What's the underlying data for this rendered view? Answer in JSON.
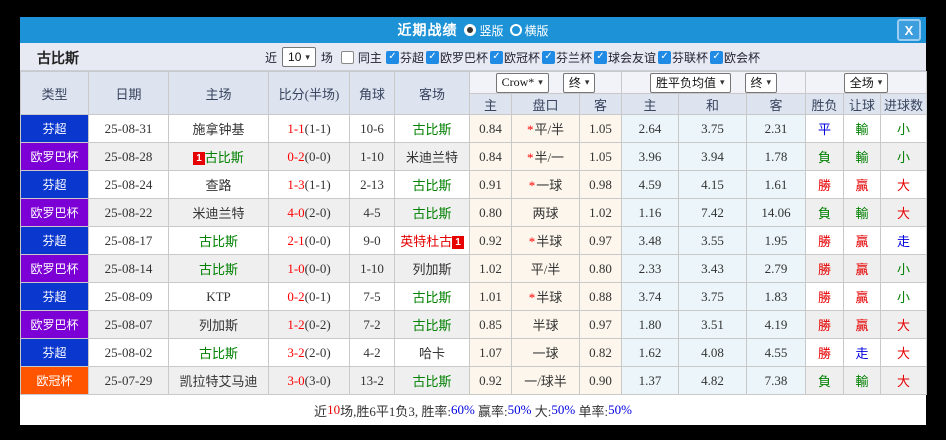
{
  "titlebar": {
    "title": "近期战绩",
    "layout_vertical": "竖版",
    "layout_horizontal": "横版",
    "close_label": "X"
  },
  "filterbar": {
    "team": "古比斯",
    "recent_prefix": "近",
    "recent_value": "10",
    "recent_suffix": "场",
    "same_home_label": "同主",
    "leagues": [
      "芬超",
      "欧罗巴杯",
      "欧冠杯",
      "芬兰杯",
      "球会友谊",
      "芬联杯",
      "欧会杯"
    ]
  },
  "table": {
    "main_headers": [
      "类型",
      "日期",
      "主场",
      "比分(半场)",
      "角球",
      "客场"
    ],
    "sub_headers": [
      "主",
      "盘口",
      "客",
      "主",
      "和",
      "客",
      "胜负",
      "让球",
      "进球数"
    ],
    "selects": {
      "odds_company": "Crow*",
      "odds_time": "终",
      "wdl_mode": "胜平负均值",
      "wdl_time": "终",
      "scope": "全场"
    },
    "rows": [
      {
        "league": "芬超",
        "date": "25-08-31",
        "home": "施拿钟基",
        "home_color": "dark",
        "home_card": "",
        "score": "1-1",
        "half": "(1-1)",
        "corner": "10-6",
        "away": "古比斯",
        "away_color": "green",
        "away_card": "",
        "ah_home": "0.84",
        "ah_line": "平/半",
        "ah_star": true,
        "ah_away": "1.05",
        "eu_home": "2.64",
        "eu_draw": "3.75",
        "eu_away": "2.31",
        "res_wdl": "平",
        "res_wdl_color": "blue",
        "res_ah": "輸",
        "res_ah_color": "green",
        "res_ou": "小",
        "res_ou_color": "green"
      },
      {
        "league": "欧罗巴杯",
        "date": "25-08-28",
        "home": "古比斯",
        "home_color": "green",
        "home_card": "1",
        "score": "0-2",
        "half": "(0-0)",
        "corner": "1-10",
        "away": "米迪兰特",
        "away_color": "dark",
        "away_card": "",
        "ah_home": "0.84",
        "ah_line": "半/一",
        "ah_star": true,
        "ah_away": "1.05",
        "eu_home": "3.96",
        "eu_draw": "3.94",
        "eu_away": "1.78",
        "res_wdl": "負",
        "res_wdl_color": "green",
        "res_ah": "輸",
        "res_ah_color": "green",
        "res_ou": "小",
        "res_ou_color": "green"
      },
      {
        "league": "芬超",
        "date": "25-08-24",
        "home": "查路",
        "home_color": "dark",
        "home_card": "",
        "score": "1-3",
        "half": "(1-1)",
        "corner": "2-13",
        "away": "古比斯",
        "away_color": "green",
        "away_card": "",
        "ah_home": "0.91",
        "ah_line": "一球",
        "ah_star": true,
        "ah_away": "0.98",
        "eu_home": "4.59",
        "eu_draw": "4.15",
        "eu_away": "1.61",
        "res_wdl": "勝",
        "res_wdl_color": "red",
        "res_ah": "贏",
        "res_ah_color": "red",
        "res_ou": "大",
        "res_ou_color": "red"
      },
      {
        "league": "欧罗巴杯",
        "date": "25-08-22",
        "home": "米迪兰特",
        "home_color": "dark",
        "home_card": "",
        "score": "4-0",
        "half": "(2-0)",
        "corner": "4-5",
        "away": "古比斯",
        "away_color": "green",
        "away_card": "",
        "ah_home": "0.80",
        "ah_line": "两球",
        "ah_star": false,
        "ah_away": "1.02",
        "eu_home": "1.16",
        "eu_draw": "7.42",
        "eu_away": "14.06",
        "res_wdl": "負",
        "res_wdl_color": "green",
        "res_ah": "輸",
        "res_ah_color": "green",
        "res_ou": "大",
        "res_ou_color": "red"
      },
      {
        "league": "芬超",
        "date": "25-08-17",
        "home": "古比斯",
        "home_color": "green",
        "home_card": "",
        "score": "2-1",
        "half": "(0-0)",
        "corner": "9-0",
        "away": "英特杜古",
        "away_color": "red",
        "away_card": "1",
        "ah_home": "0.92",
        "ah_line": "半球",
        "ah_star": true,
        "ah_away": "0.97",
        "eu_home": "3.48",
        "eu_draw": "3.55",
        "eu_away": "1.95",
        "res_wdl": "勝",
        "res_wdl_color": "red",
        "res_ah": "贏",
        "res_ah_color": "red",
        "res_ou": "走",
        "res_ou_color": "blue"
      },
      {
        "league": "欧罗巴杯",
        "date": "25-08-14",
        "home": "古比斯",
        "home_color": "green",
        "home_card": "",
        "score": "1-0",
        "half": "(0-0)",
        "corner": "1-10",
        "away": "列加斯",
        "away_color": "dark",
        "away_card": "",
        "ah_home": "1.02",
        "ah_line": "平/半",
        "ah_star": false,
        "ah_away": "0.80",
        "eu_home": "2.33",
        "eu_draw": "3.43",
        "eu_away": "2.79",
        "res_wdl": "勝",
        "res_wdl_color": "red",
        "res_ah": "贏",
        "res_ah_color": "red",
        "res_ou": "小",
        "res_ou_color": "green"
      },
      {
        "league": "芬超",
        "date": "25-08-09",
        "home": "KTP",
        "home_color": "dark",
        "home_card": "",
        "score": "0-2",
        "half": "(0-1)",
        "corner": "7-5",
        "away": "古比斯",
        "away_color": "green",
        "away_card": "",
        "ah_home": "1.01",
        "ah_line": "半球",
        "ah_star": true,
        "ah_away": "0.88",
        "eu_home": "3.74",
        "eu_draw": "3.75",
        "eu_away": "1.83",
        "res_wdl": "勝",
        "res_wdl_color": "red",
        "res_ah": "贏",
        "res_ah_color": "red",
        "res_ou": "小",
        "res_ou_color": "green"
      },
      {
        "league": "欧罗巴杯",
        "date": "25-08-07",
        "home": "列加斯",
        "home_color": "dark",
        "home_card": "",
        "score": "1-2",
        "half": "(0-2)",
        "corner": "7-2",
        "away": "古比斯",
        "away_color": "green",
        "away_card": "",
        "ah_home": "0.85",
        "ah_line": "半球",
        "ah_star": false,
        "ah_away": "0.97",
        "eu_home": "1.80",
        "eu_draw": "3.51",
        "eu_away": "4.19",
        "res_wdl": "勝",
        "res_wdl_color": "red",
        "res_ah": "贏",
        "res_ah_color": "red",
        "res_ou": "大",
        "res_ou_color": "red"
      },
      {
        "league": "芬超",
        "date": "25-08-02",
        "home": "古比斯",
        "home_color": "green",
        "home_card": "",
        "score": "3-2",
        "half": "(2-0)",
        "corner": "4-2",
        "away": "哈卡",
        "away_color": "dark",
        "away_card": "",
        "ah_home": "1.07",
        "ah_line": "一球",
        "ah_star": false,
        "ah_away": "0.82",
        "eu_home": "1.62",
        "eu_draw": "4.08",
        "eu_away": "4.55",
        "res_wdl": "勝",
        "res_wdl_color": "red",
        "res_ah": "走",
        "res_ah_color": "blue",
        "res_ou": "大",
        "res_ou_color": "red"
      },
      {
        "league": "欧冠杯",
        "date": "25-07-29",
        "home": "凯拉特艾马迪",
        "home_color": "dark",
        "home_card": "",
        "score": "3-0",
        "half": "(3-0)",
        "corner": "13-2",
        "away": "古比斯",
        "away_color": "green",
        "away_card": "",
        "ah_home": "0.92",
        "ah_line": "一/球半",
        "ah_star": false,
        "ah_away": "0.90",
        "eu_home": "1.37",
        "eu_draw": "4.82",
        "eu_away": "7.38",
        "res_wdl": "負",
        "res_wdl_color": "green",
        "res_ah": "輸",
        "res_ah_color": "green",
        "res_ou": "大",
        "res_ou_color": "red"
      }
    ]
  },
  "summary": {
    "parts": [
      {
        "text": "近",
        "color": "dark"
      },
      {
        "text": "10",
        "color": "red"
      },
      {
        "text": "场,胜6平1负3, 胜率:",
        "color": "dark"
      },
      {
        "text": "60%",
        "color": "blue"
      },
      {
        "text": " 赢率:",
        "color": "dark"
      },
      {
        "text": "50%",
        "color": "blue"
      },
      {
        "text": " 大:",
        "color": "dark"
      },
      {
        "text": "50%",
        "color": "blue"
      },
      {
        "text": " 单率:",
        "color": "dark"
      },
      {
        "text": "50%",
        "color": "blue"
      }
    ]
  },
  "colors": {
    "accent": "#1d92d6",
    "league_badges": {
      "芬超": "#0a38cf",
      "欧罗巴杯": "#7c00d5",
      "欧冠杯": "#ff5400"
    },
    "checkbox_checked": "#1f8be4"
  }
}
